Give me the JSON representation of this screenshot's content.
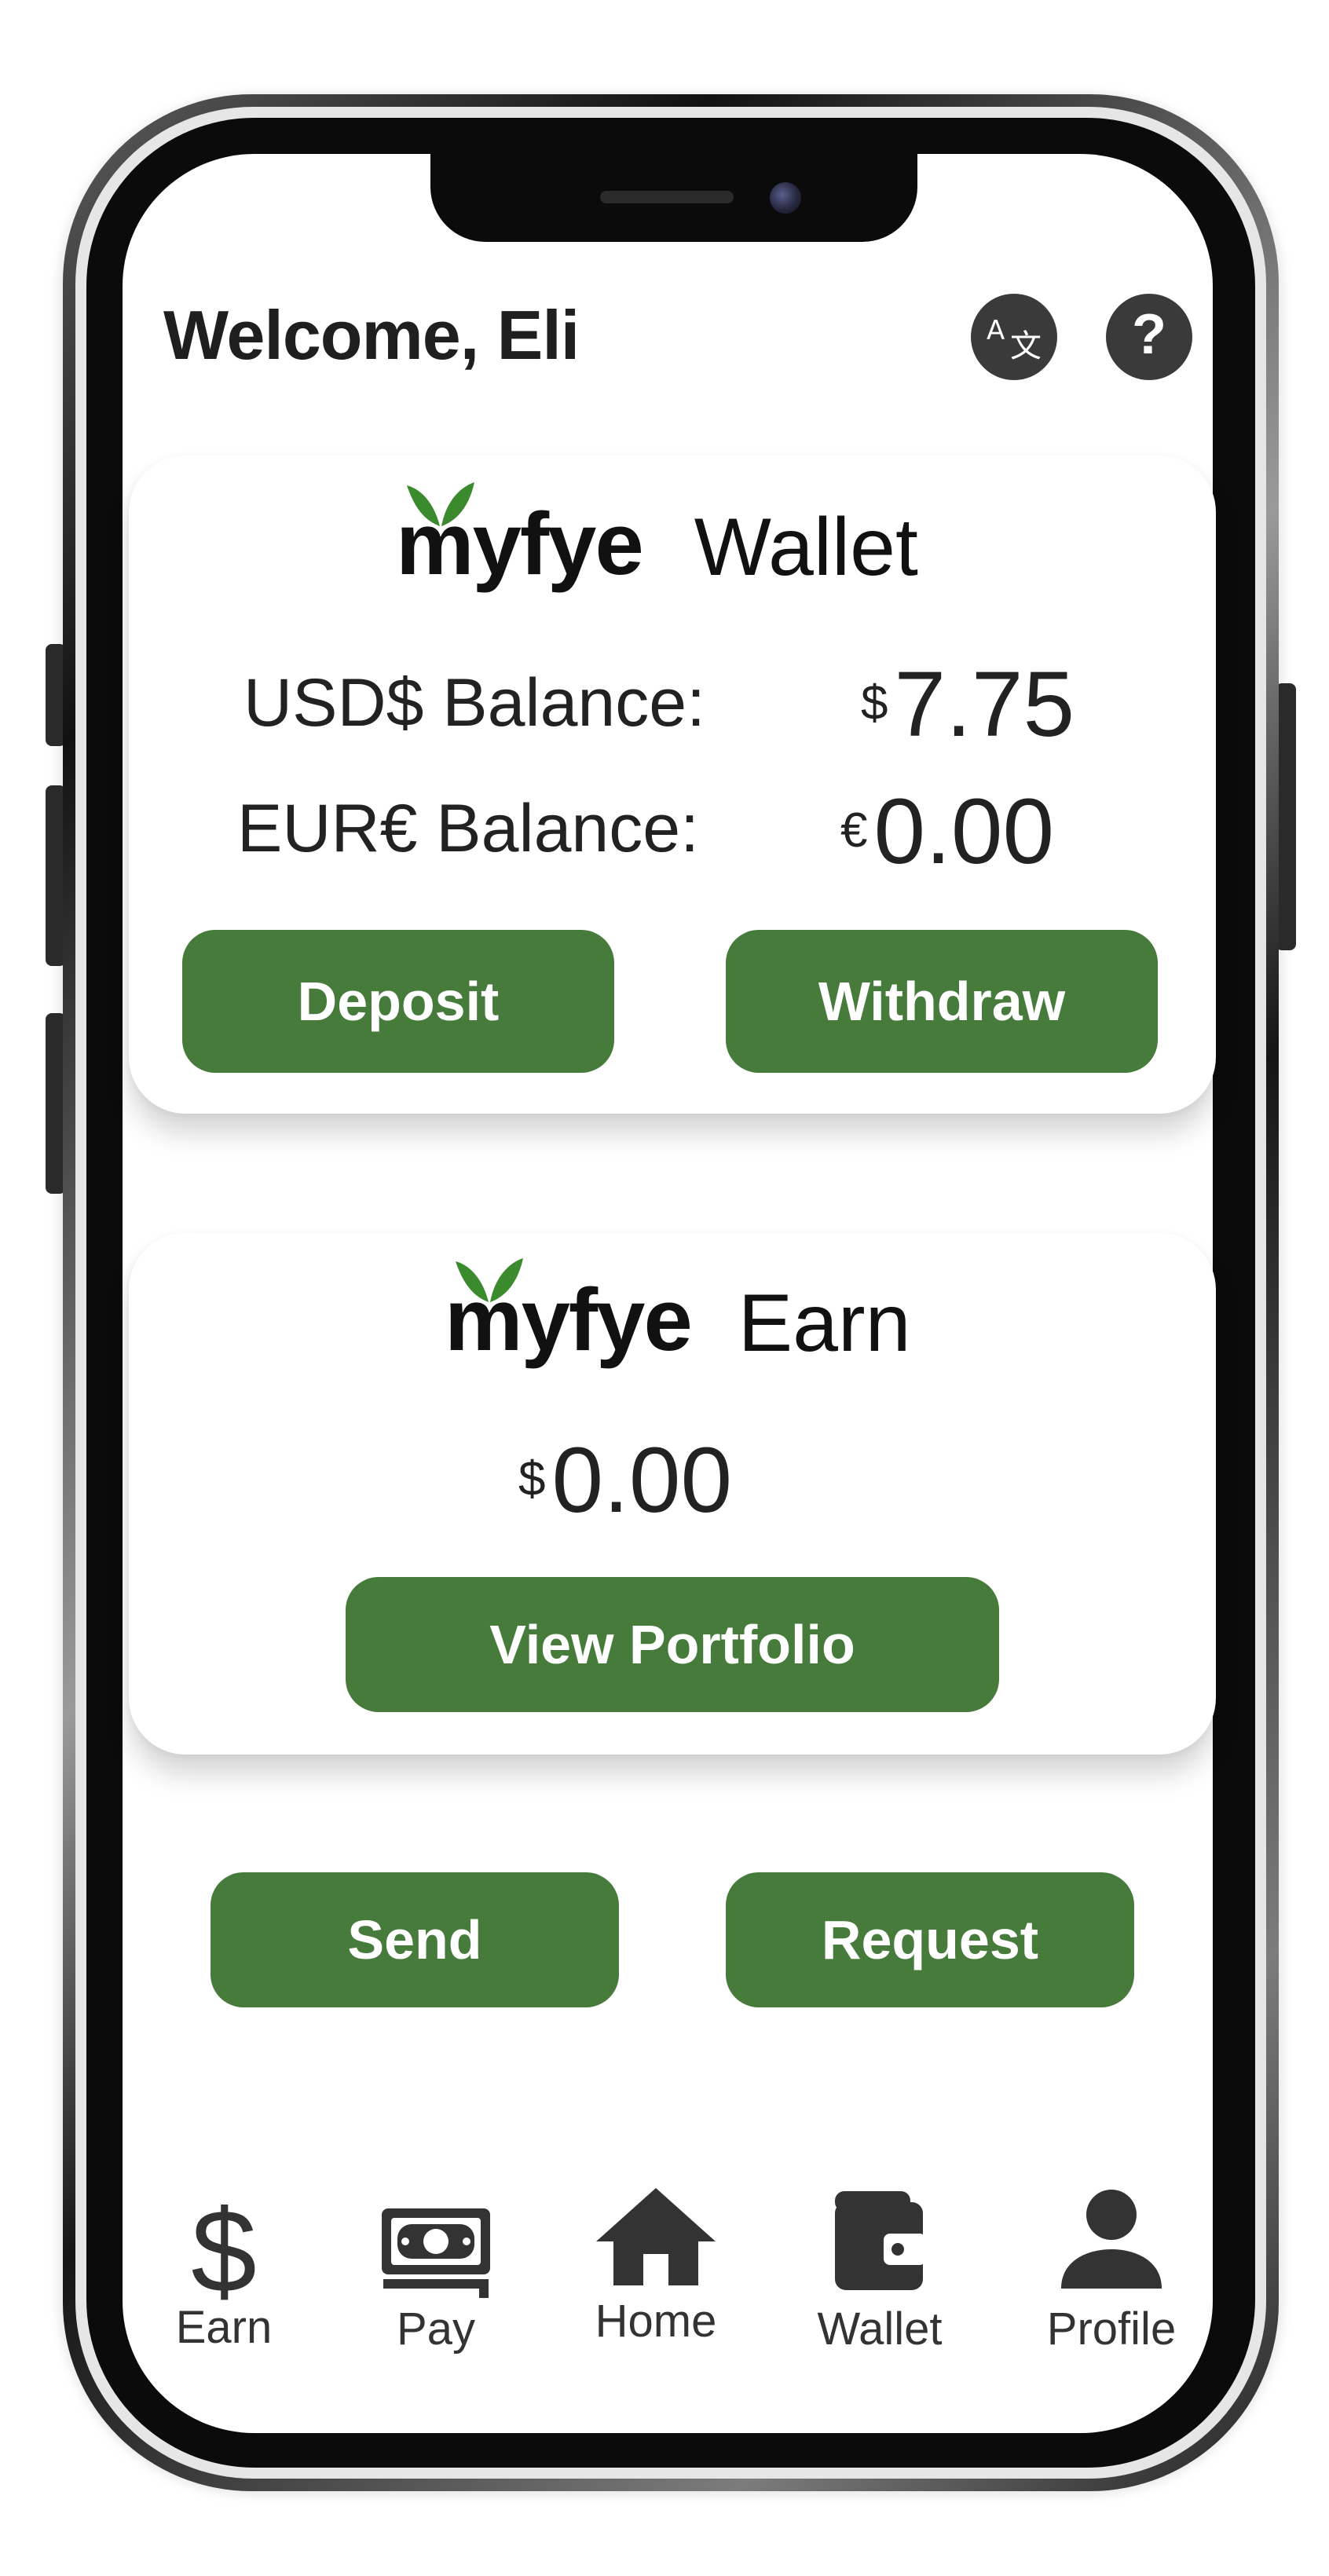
{
  "header": {
    "welcome_text": "Welcome, Eli",
    "translate_icon": "translate-icon",
    "help_icon": "help-icon"
  },
  "brand": {
    "logo_text": "myfye",
    "leaf_color": "#3c8a2e"
  },
  "wallet_card": {
    "title": "Wallet",
    "usd_label": "USD$ Balance:",
    "usd_symbol": "$",
    "usd_value": "7.75",
    "eur_label": "EUR€ Balance:",
    "eur_symbol": "€",
    "eur_value": "0.00",
    "deposit_label": "Deposit",
    "withdraw_label": "Withdraw"
  },
  "earn_card": {
    "title": "Earn",
    "symbol": "$",
    "value": "0.00",
    "view_portfolio_label": "View Portfolio"
  },
  "actions": {
    "send_label": "Send",
    "request_label": "Request"
  },
  "bottom_nav": [
    {
      "label": "Earn",
      "icon": "dollar-icon"
    },
    {
      "label": "Pay",
      "icon": "cash-icon"
    },
    {
      "label": "Home",
      "icon": "home-icon"
    },
    {
      "label": "Wallet",
      "icon": "wallet-icon"
    },
    {
      "label": "Profile",
      "icon": "person-icon"
    }
  ],
  "colors": {
    "button_green": "#467b3b",
    "icon_dark": "#333333"
  }
}
